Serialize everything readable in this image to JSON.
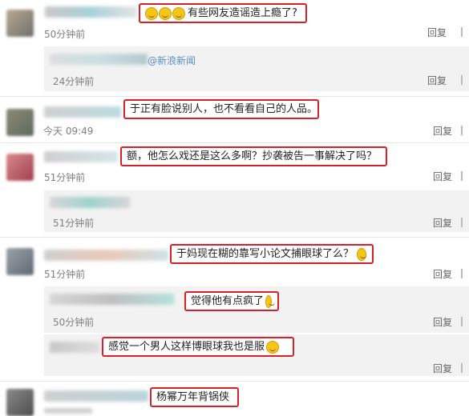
{
  "comments": [
    {
      "text": "有些网友造谣造上瘾了?",
      "time": "50分钟前",
      "reply": "回复"
    },
    {
      "source": "@新浪新闻",
      "time": "24分钟前",
      "reply": "回复"
    },
    {
      "text": "于正有脸说别人，也不看看自己的人品。",
      "time": "今天 09:49",
      "reply": "回复"
    },
    {
      "text": "额，他怎么戏还是这么多啊？抄袭被告一事解决了吗？",
      "time": "51分钟前",
      "reply": "回复"
    },
    {
      "time": "51分钟前",
      "reply": "回复"
    },
    {
      "text": "于妈现在糊的靠写小论文捕眼球了么？",
      "time": "51分钟前",
      "reply": "回复"
    },
    {
      "text": "觉得他有点疯了",
      "time": "50分钟前",
      "reply": "回复"
    },
    {
      "text": "感觉一个男人这样博眼球我也是服",
      "time": "",
      "reply": "回复"
    },
    {
      "text": "杨幂万年背锅侠",
      "time": "",
      "reply": ""
    }
  ],
  "emoji": [
    "laugh-cry-emoji",
    "smile-emoji",
    "grin-emoji"
  ],
  "colors": {
    "highlight": "#d8202b",
    "link": "#5a8fc7",
    "subbg": "#f2f2f2"
  }
}
